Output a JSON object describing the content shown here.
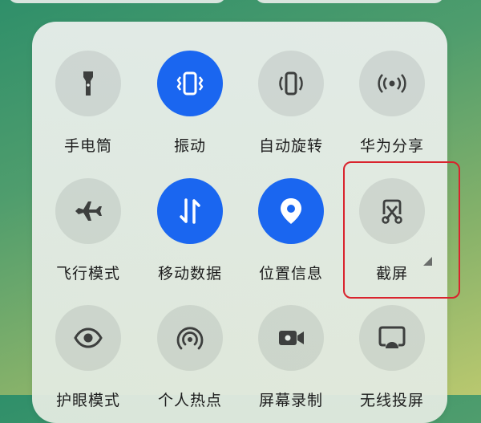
{
  "tiles": [
    {
      "id": "flashlight",
      "label": "手电筒",
      "icon": "flashlight-icon",
      "active": false
    },
    {
      "id": "vibrate",
      "label": "振动",
      "icon": "vibrate-icon",
      "active": true
    },
    {
      "id": "auto-rotate",
      "label": "自动旋转",
      "icon": "auto-rotate-icon",
      "active": false
    },
    {
      "id": "huawei-share",
      "label": "华为分享",
      "icon": "share-broadcast-icon",
      "active": false
    },
    {
      "id": "airplane",
      "label": "飞行模式",
      "icon": "airplane-icon",
      "active": false
    },
    {
      "id": "mobile-data",
      "label": "移动数据",
      "icon": "mobile-data-icon",
      "active": true
    },
    {
      "id": "location",
      "label": "位置信息",
      "icon": "location-pin-icon",
      "active": true
    },
    {
      "id": "screenshot",
      "label": "截屏",
      "icon": "screenshot-scissors-icon",
      "active": false
    },
    {
      "id": "eye-comfort",
      "label": "护眼模式",
      "icon": "eye-icon",
      "active": false
    },
    {
      "id": "hotspot",
      "label": "个人热点",
      "icon": "hotspot-icon",
      "active": false
    },
    {
      "id": "screen-record",
      "label": "屏幕录制",
      "icon": "video-camera-icon",
      "active": false
    },
    {
      "id": "wireless-projection",
      "label": "无线投屏",
      "icon": "cast-screen-icon",
      "active": false
    }
  ],
  "colors": {
    "active": "#1a66f0",
    "highlight": "#d9232d",
    "icon_inactive": "#3d3f3e"
  }
}
